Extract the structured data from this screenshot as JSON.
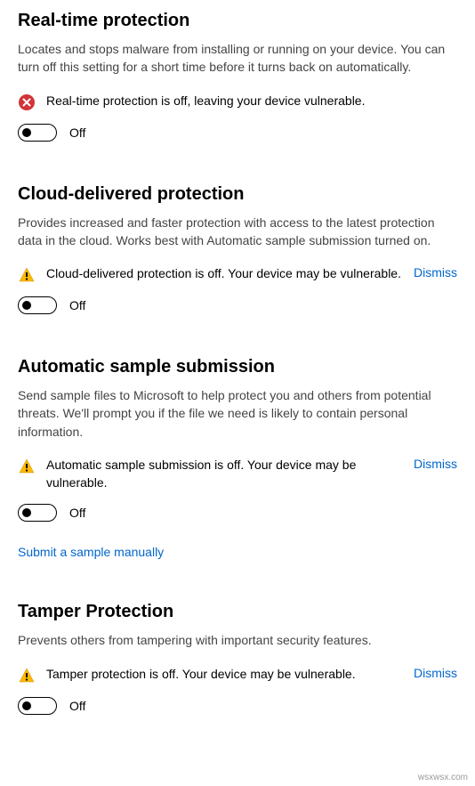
{
  "sections": {
    "realtime": {
      "title": "Real-time protection",
      "description": "Locates and stops malware from installing or running on your device. You can turn off this setting for a short time before it turns back on automatically.",
      "alert": "Real-time protection is off, leaving your device vulnerable.",
      "toggle_label": "Off"
    },
    "cloud": {
      "title": "Cloud-delivered protection",
      "description": "Provides increased and faster protection with access to the latest protection data in the cloud. Works best with Automatic sample submission turned on.",
      "alert": "Cloud-delivered protection is off. Your device may be vulnerable.",
      "dismiss": "Dismiss",
      "toggle_label": "Off"
    },
    "sample": {
      "title": "Automatic sample submission",
      "description": "Send sample files to Microsoft to help protect you and others from potential threats. We'll prompt you if the file we need is likely to contain personal information.",
      "alert": "Automatic sample submission is off. Your device may be vulnerable.",
      "dismiss": "Dismiss",
      "toggle_label": "Off",
      "manual_link": "Submit a sample manually"
    },
    "tamper": {
      "title": "Tamper Protection",
      "description": "Prevents others from tampering with important security features.",
      "alert": "Tamper protection is off. Your device may be vulnerable.",
      "dismiss": "Dismiss",
      "toggle_label": "Off"
    }
  },
  "watermark": "wsxwsx.com"
}
